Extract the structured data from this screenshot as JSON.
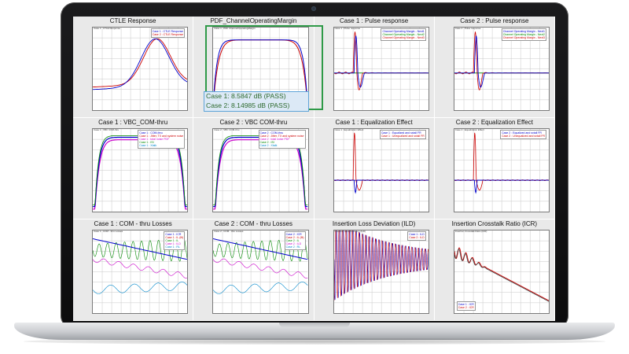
{
  "panels": [
    {
      "title": "CTLE Response",
      "legend": [
        "Case 1 : CTLE Response",
        "Case 2 : CTLE Response"
      ],
      "legend_colors": [
        "#0000cc",
        "#cc0000"
      ],
      "side": "",
      "toplabel": "Case 1 : CTLE Response",
      "curve": "ctle"
    },
    {
      "title": "PDF_ChannelOperatingMargin",
      "legend": [],
      "legend_colors": [],
      "side": "",
      "toplabel": "Case 1 : PDF ChannelOperatingMargin",
      "curve": "pdf"
    },
    {
      "title": "Case 1 : Pulse response",
      "legend": [
        "Channel Operating Margin - Next1",
        "Channel Operating Margin - Next2",
        "Channel Operating Margin - Next3"
      ],
      "legend_colors": [
        "#0000cc",
        "#008800",
        "#cc0000"
      ],
      "side": "",
      "toplabel": "Case 1 : Pulse response",
      "curve": "pulse"
    },
    {
      "title": "Case 2 : Pulse response",
      "legend": [
        "Channel Operating Margin - Next1",
        "Channel Operating Margin - Next2",
        "Channel Operating Margin - Next3"
      ],
      "legend_colors": [
        "#0000cc",
        "#008800",
        "#cc0000"
      ],
      "side": "",
      "toplabel": "Case 2 : Pulse response",
      "curve": "pulse"
    },
    {
      "title": "Case 1 : VBC_COM-thru",
      "legend": [
        "Case 1 : COM-thru",
        "Case 1 : Jitter, TX and system noise",
        "Case 1 : total noise PDF",
        "Case 1 : ISI",
        "Case 1 : Xtalk"
      ],
      "legend_colors": [
        "#0000cc",
        "#cc0000",
        "#cc00cc",
        "#008800",
        "#0088cc"
      ],
      "side": "",
      "toplabel": "Case 1 : VBC COM-thru",
      "curve": "vbc"
    },
    {
      "title": "Case 2 : VBC COM-thru",
      "legend": [
        "Case 2 : COM-thru",
        "Case 2 : Jitter, TX and system noise",
        "Case 2 : total noise PDF",
        "Case 2 : ISI",
        "Case 2 : Xtalk"
      ],
      "legend_colors": [
        "#0000cc",
        "#cc0000",
        "#cc00cc",
        "#008800",
        "#0088cc"
      ],
      "side": "",
      "toplabel": "Case 2 : VBC COM-thru",
      "curve": "vbc"
    },
    {
      "title": "Case 1 : Equalization Effect",
      "legend": [
        "Case 1 : Equalized and sxtall FR",
        "Case 1 : Unequalized and sxtall FR"
      ],
      "legend_colors": [
        "#0000cc",
        "#cc0000"
      ],
      "side": "",
      "toplabel": "Case 1 : Equalization Effect",
      "curve": "eq"
    },
    {
      "title": "Case 2 : Equalization Effect",
      "legend": [
        "Case 2 : Equalized and sxtall FR",
        "Case 2 : Unequalized and sxtall FR"
      ],
      "legend_colors": [
        "#0000cc",
        "#cc0000"
      ],
      "side": "",
      "toplabel": "Case 2 : Equalization Effect",
      "curve": "eq"
    },
    {
      "title": "Case 1 : COM - thru Losses",
      "legend": [
        "Case 1 : ICR",
        "Case 1 : IL (fit)",
        "Case 1 : IL",
        "Case 1 : ILD",
        "Case 1 : RL"
      ],
      "legend_colors": [
        "#0000cc",
        "#cc0000",
        "#008800",
        "#cc00cc",
        "#0088cc"
      ],
      "side": "",
      "toplabel": "Case 1 : COM - thru Losses",
      "curve": "loss"
    },
    {
      "title": "Case 2 : COM - thru Losses",
      "legend": [
        "Case 2 : ICR",
        "Case 2 : IL (fit)",
        "Case 2 : IL",
        "Case 2 : ILD",
        "Case 2 : RL"
      ],
      "legend_colors": [
        "#0000cc",
        "#cc0000",
        "#008800",
        "#cc00cc",
        "#0088cc"
      ],
      "side": "",
      "toplabel": "Case 2 : COM - thru Losses",
      "curve": "loss"
    },
    {
      "title": "Insertion Loss Deviation (ILD)",
      "legend": [
        "Case 1 : ILD",
        "Case 2 : ILD"
      ],
      "legend_colors": [
        "#0000cc",
        "#cc0000"
      ],
      "side": "",
      "toplabel": "Insertion Loss Deviation (ILD)",
      "curve": "ild"
    },
    {
      "title": "Insertion Crosstalk Ratio (ICR)",
      "legend": [
        "Case 1 : ICR",
        "Case 2 : ICR"
      ],
      "legend_colors": [
        "#0000cc",
        "#cc0000"
      ],
      "side": "",
      "toplabel": "Insertion Crosstalk Ratio (ICR)",
      "curve": "icr"
    }
  ],
  "margin": {
    "case1": "Case 1: 8.5847 dB (PASS)",
    "case2": "Case 2: 8.14985 dB (PASS)"
  }
}
